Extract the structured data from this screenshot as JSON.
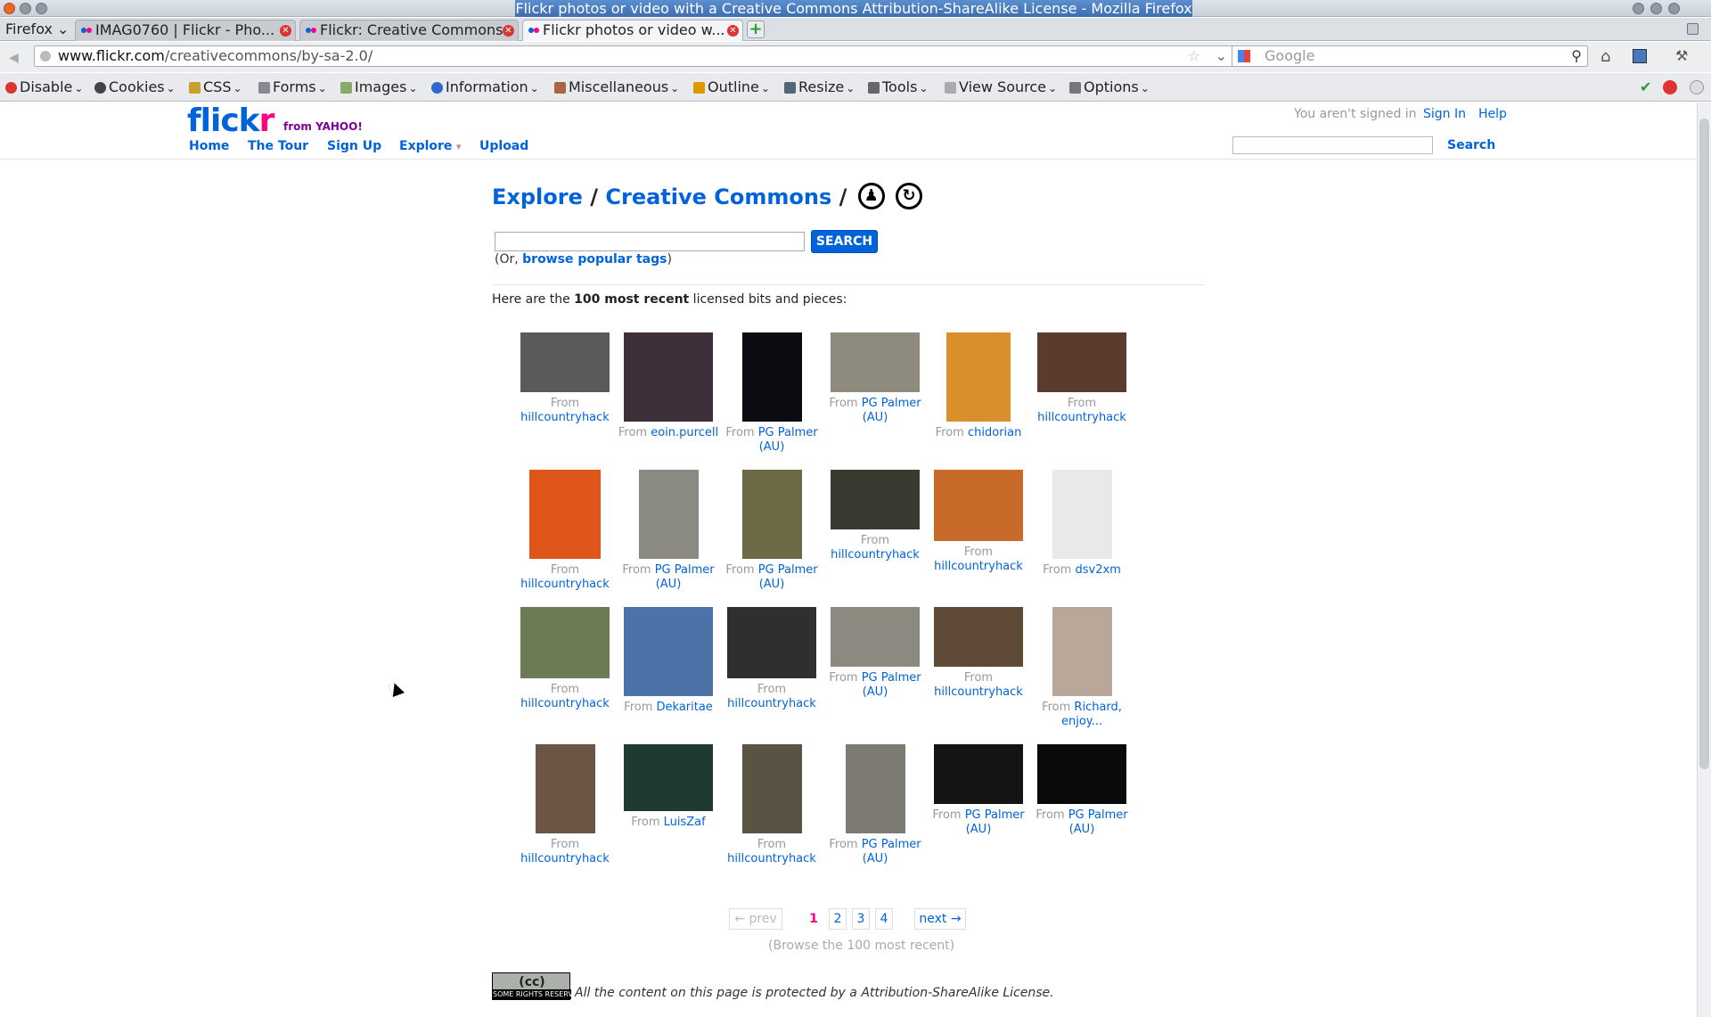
{
  "window": {
    "title": "Flickr photos or video with a Creative Commons Attribution-ShareAlike License - Mozilla Firefox"
  },
  "menu": {
    "firefox": "Firefox"
  },
  "tabs": [
    {
      "label": "IMAG0760 | Flickr - Pho..."
    },
    {
      "label": "Flickr: Creative Commons"
    },
    {
      "label": "Flickr photos or video w..."
    }
  ],
  "newtab": "+",
  "url": {
    "domain": "www.flickr.com",
    "path": "/creativecommons/by-sa-2.0/"
  },
  "search_engine": {
    "placeholder": "Google"
  },
  "devbar": [
    "Disable",
    "Cookies",
    "CSS",
    "Forms",
    "Images",
    "Information",
    "Miscellaneous",
    "Outline",
    "Resize",
    "Tools",
    "View Source",
    "Options"
  ],
  "header": {
    "logo": {
      "part1": "flick",
      "part2": "r",
      "from": "from YAHOO!"
    },
    "nav": [
      "Home",
      "The Tour",
      "Sign Up",
      "Explore",
      "Upload"
    ],
    "status": "You aren't signed in",
    "sign_in": "Sign In",
    "help": "Help",
    "search_btn": "Search"
  },
  "crumb": {
    "explore": "Explore",
    "sep": "/",
    "cc": "Creative Commons"
  },
  "search": {
    "button": "SEARCH",
    "or_prefix": "(Or, ",
    "browse_tags": "browse popular tags",
    "or_suffix": ")"
  },
  "intro": {
    "prefix": "Here are the ",
    "bold": "100 most recent",
    "suffix": " licensed bits and pieces:"
  },
  "photos": [
    {
      "from": "From",
      "user": "hillcountryhack",
      "color": "#5a5a5a"
    },
    {
      "from": "From",
      "user": "eoin.purcell",
      "color": "#3f2f3a"
    },
    {
      "from": "From",
      "user": "PG Palmer (AU)",
      "color": "#0b0b12"
    },
    {
      "from": "From",
      "user": "PG Palmer (AU)",
      "color": "#8e8a7d"
    },
    {
      "from": "From",
      "user": "chidorian",
      "color": "#d9902c"
    },
    {
      "from": "From",
      "user": "hillcountryhack",
      "color": "#5b3b2d"
    },
    {
      "from": "From",
      "user": "hillcountryhack",
      "color": "#e0561a"
    },
    {
      "from": "From",
      "user": "PG Palmer (AU)",
      "color": "#8a8a82"
    },
    {
      "from": "From",
      "user": "PG Palmer (AU)",
      "color": "#6d6a45"
    },
    {
      "from": "From",
      "user": "hillcountryhack",
      "color": "#3a3a30"
    },
    {
      "from": "From",
      "user": "hillcountryhack",
      "color": "#c86a2a"
    },
    {
      "from": "From",
      "user": "dsv2xm",
      "color": "#e9e9e9"
    },
    {
      "from": "From",
      "user": "hillcountryhack",
      "color": "#6b7c55"
    },
    {
      "from": "From",
      "user": "Dekaritae",
      "color": "#4b73a8"
    },
    {
      "from": "From",
      "user": "hillcountryhack",
      "color": "#2f2f2f"
    },
    {
      "from": "From",
      "user": "PG Palmer (AU)",
      "color": "#8c8a80"
    },
    {
      "from": "From",
      "user": "hillcountryhack",
      "color": "#5e4a36"
    },
    {
      "from": "From",
      "user": "Richard, enjoy...",
      "color": "#b9a89a"
    },
    {
      "from": "From",
      "user": "hillcountryhack",
      "color": "#6b5544"
    },
    {
      "from": "From",
      "user": "LuisZaf",
      "color": "#1e3a33"
    },
    {
      "from": "From",
      "user": "hillcountryhack",
      "color": "#5a5242"
    },
    {
      "from": "From",
      "user": "PG Palmer (AU)",
      "color": "#7d7b72"
    },
    {
      "from": "From",
      "user": "PG Palmer (AU)",
      "color": "#141414"
    },
    {
      "from": "From",
      "user": "PG Palmer (AU)",
      "color": "#0a0a0a"
    }
  ],
  "pagination": {
    "prev": "← prev",
    "pages": [
      "1",
      "2",
      "3",
      "4"
    ],
    "next": "next →",
    "browse": "(Browse the 100 most recent)"
  },
  "license": {
    "badge_cc": "(cc)",
    "badge_text": "SOME RIGHTS RESERVED",
    "text": "All the content on this page is protected by a Attribution-ShareAlike License."
  }
}
